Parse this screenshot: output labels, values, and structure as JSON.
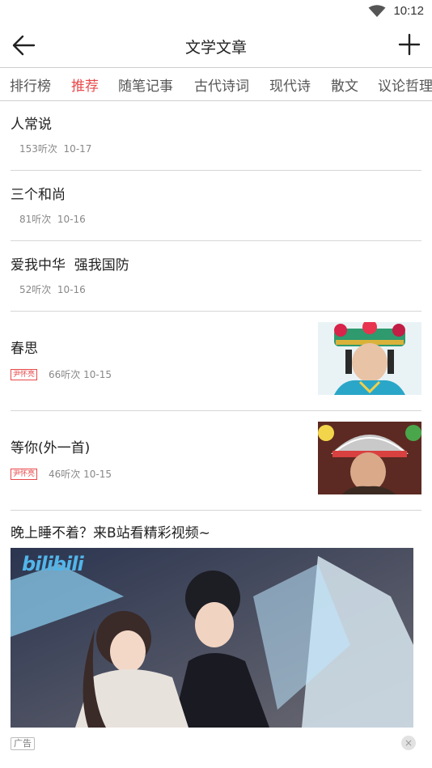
{
  "status_bar": {
    "time": "10:12",
    "wifi_icon": "wifi-icon"
  },
  "header": {
    "title": "文学文章",
    "back_icon": "back-arrow-icon",
    "add_icon": "plus-icon"
  },
  "tabs": [
    {
      "label": "排行榜",
      "active": false
    },
    {
      "label": "推荐",
      "active": true
    },
    {
      "label": "随笔记事",
      "active": false
    },
    {
      "label": "古代诗词",
      "active": false
    },
    {
      "label": "现代诗",
      "active": false
    },
    {
      "label": "散文",
      "active": false
    },
    {
      "label": "议论哲理",
      "active": false
    }
  ],
  "articles": [
    {
      "title": "人常说",
      "listens": "153听次",
      "date": "10-17"
    },
    {
      "title": "三个和尚",
      "listens": "81听次",
      "date": "10-16"
    },
    {
      "title": "爱我中华  强我国防",
      "listens": "52听次",
      "date": "10-16"
    },
    {
      "title": "春思",
      "author": "尹怀亮",
      "listens": "66听次",
      "date": "10-15"
    },
    {
      "title": "等你(外一首)",
      "author": "尹怀亮",
      "listens": "46听次",
      "date": "10-15"
    }
  ],
  "ad": {
    "title": "晚上睡不着？来B站看精彩视频~",
    "logo_text": "bilibili",
    "label": "广告",
    "close_symbol": "×"
  },
  "colors": {
    "accent": "#e8494a",
    "divider": "#d6d6d6"
  }
}
